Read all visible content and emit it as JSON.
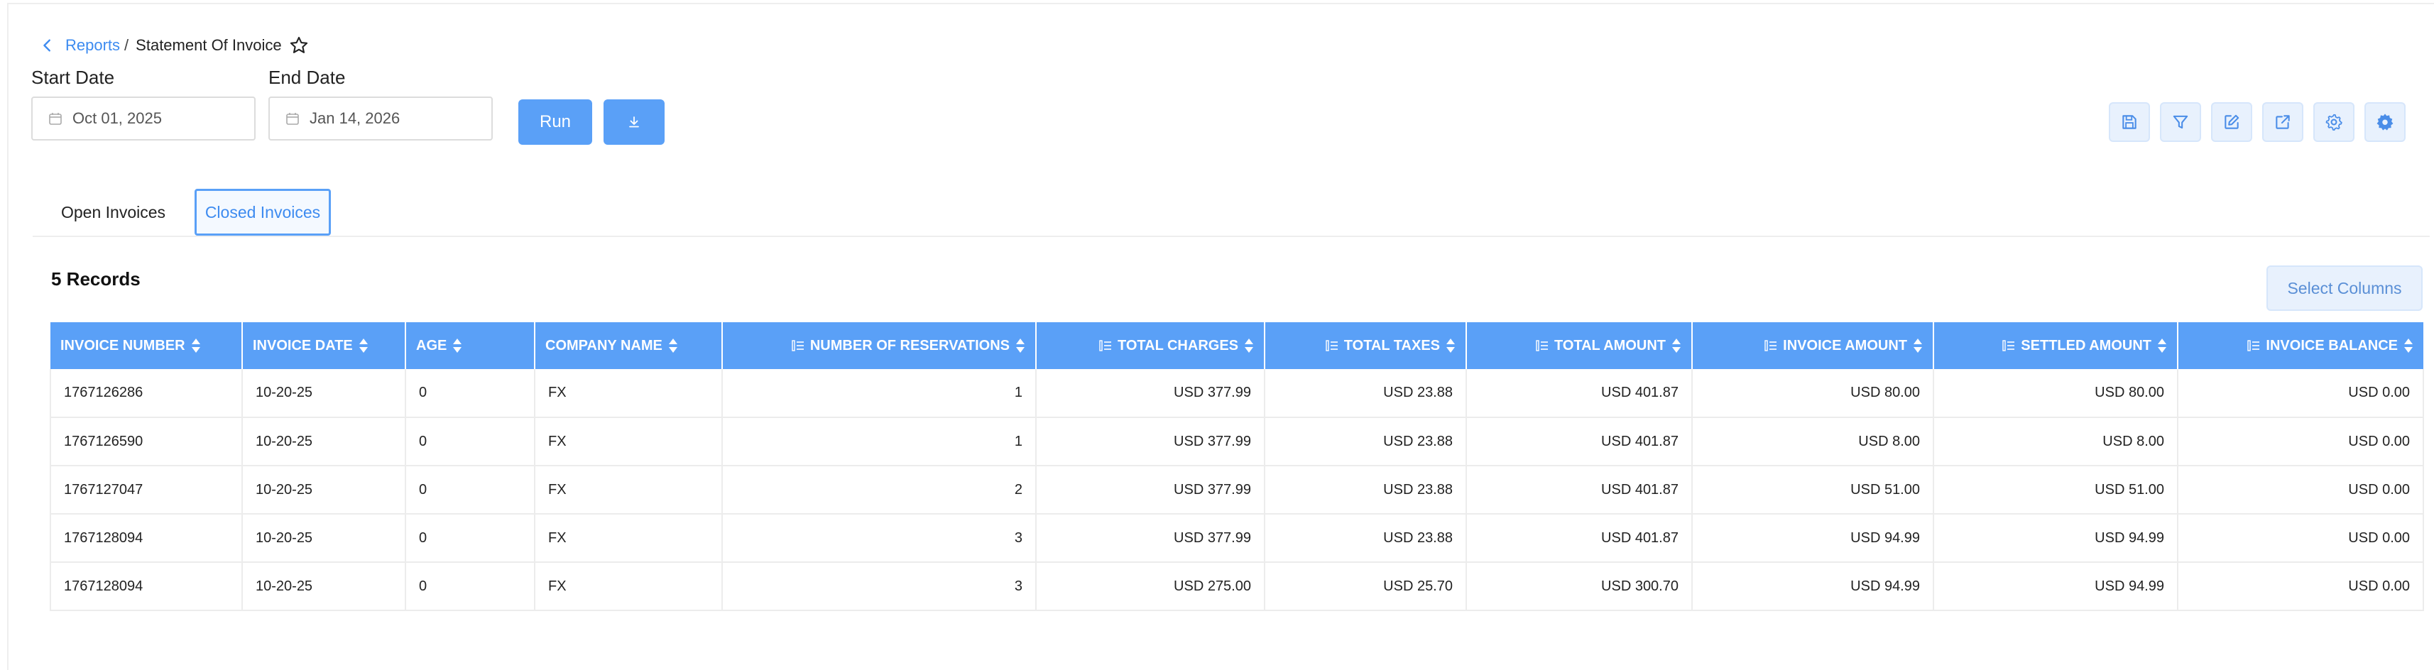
{
  "breadcrumb": {
    "parent": "Reports",
    "separator": "/",
    "current": "Statement Of Invoice"
  },
  "filters": {
    "start_label": "Start Date",
    "start_value": "Oct 01, 2025",
    "end_label": "End Date",
    "end_value": "Jan 14, 2026",
    "run_label": "Run"
  },
  "toolbar_icons": [
    "save-icon",
    "filter-icon",
    "edit-icon",
    "external-link-icon",
    "gear-icon",
    "settings-cog-icon"
  ],
  "tabs": [
    {
      "label": "Open Invoices",
      "active": false
    },
    {
      "label": "Closed Invoices",
      "active": true
    }
  ],
  "records_label": "5 Records",
  "select_columns_label": "Select Columns",
  "colors": {
    "accent": "#5aa0f7",
    "link": "#3d8bf0",
    "tool_bg": "#e8f1fd"
  },
  "table": {
    "columns": [
      {
        "label": "Invoice Number",
        "align": "txt"
      },
      {
        "label": "Invoice Date",
        "align": "txt"
      },
      {
        "label": "Age",
        "align": "txt"
      },
      {
        "label": "Company Name",
        "align": "txt"
      },
      {
        "label": "Number Of Reservations",
        "align": "num"
      },
      {
        "label": "Total Charges",
        "align": "num"
      },
      {
        "label": "Total Taxes",
        "align": "num"
      },
      {
        "label": "Total Amount",
        "align": "num"
      },
      {
        "label": "Invoice Amount",
        "align": "num"
      },
      {
        "label": "Settled Amount",
        "align": "num"
      },
      {
        "label": "Invoice Balance",
        "align": "num"
      }
    ],
    "rows": [
      [
        "1767126286",
        "10-20-25",
        "0",
        "FX",
        "1",
        "USD 377.99",
        "USD 23.88",
        "USD 401.87",
        "USD 80.00",
        "USD 80.00",
        "USD 0.00"
      ],
      [
        "1767126590",
        "10-20-25",
        "0",
        "FX",
        "1",
        "USD 377.99",
        "USD 23.88",
        "USD 401.87",
        "USD 8.00",
        "USD 8.00",
        "USD 0.00"
      ],
      [
        "1767127047",
        "10-20-25",
        "0",
        "FX",
        "2",
        "USD 377.99",
        "USD 23.88",
        "USD 401.87",
        "USD 51.00",
        "USD 51.00",
        "USD 0.00"
      ],
      [
        "1767128094",
        "10-20-25",
        "0",
        "FX",
        "3",
        "USD 377.99",
        "USD 23.88",
        "USD 401.87",
        "USD 94.99",
        "USD 94.99",
        "USD 0.00"
      ],
      [
        "1767128094",
        "10-20-25",
        "0",
        "FX",
        "3",
        "USD 275.00",
        "USD 25.70",
        "USD 300.70",
        "USD 94.99",
        "USD 94.99",
        "USD 0.00"
      ]
    ]
  }
}
